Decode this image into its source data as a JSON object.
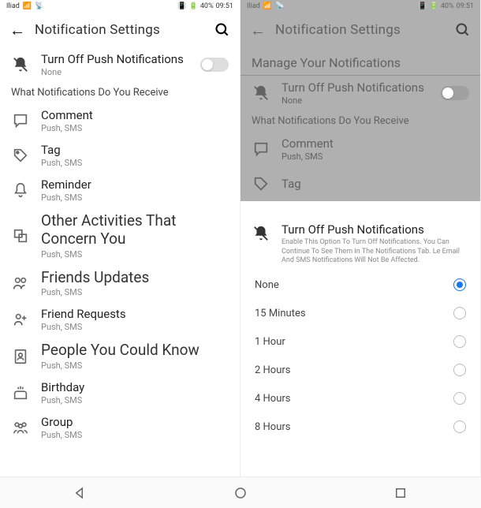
{
  "status": {
    "carrier": "Iliad",
    "battery": "40%",
    "time": "09:51",
    "vibrate_icon": "vibrate"
  },
  "left": {
    "header_title": "Notification Settings",
    "push_row": {
      "title": "Turn Off Push Notifications",
      "sub": "None"
    },
    "section_title": "What Notifications Do You Receive",
    "items": [
      {
        "title": "Comment",
        "sub": "Push, SMS"
      },
      {
        "title": "Tag",
        "sub": "Push, SMS"
      },
      {
        "title": "Reminder",
        "sub": "Push, SMS"
      },
      {
        "title": "Other Activities That Concern You",
        "sub": "Push, SMS"
      },
      {
        "title": "Friends Updates",
        "sub": "Push, SMS"
      },
      {
        "title": "Friend Requests",
        "sub": "Push, SMS"
      },
      {
        "title": "People You Could Know",
        "sub": "Push, SMS"
      },
      {
        "title": "Birthday",
        "sub": "Push, SMS"
      },
      {
        "title": "Group",
        "sub": "Push, SMS"
      }
    ]
  },
  "right": {
    "header_title": "Notification Settings",
    "manage_title": "Manage Your Notifications",
    "push_row": {
      "title": "Turn Off Push Notifications",
      "sub": "None"
    },
    "section_title": "What Notifications Do You Receive",
    "items": [
      {
        "title": "Comment",
        "sub": "Push, SMS"
      },
      {
        "title": "Tag",
        "sub": ""
      }
    ],
    "sheet": {
      "title": "Turn Off Push Notifications",
      "desc": "Enable This Option To Turn Off Notifications. You Can Continue To See Them In The Notifications Tab. Le Email And SMS Notifications Will Not Be Affected.",
      "options": [
        {
          "label": "None",
          "selected": true
        },
        {
          "label": "15 Minutes",
          "selected": false
        },
        {
          "label": "1 Hour",
          "selected": false
        },
        {
          "label": "2 Hours",
          "selected": false
        },
        {
          "label": "4 Hours",
          "selected": false
        },
        {
          "label": "8 Hours",
          "selected": false
        }
      ]
    }
  }
}
